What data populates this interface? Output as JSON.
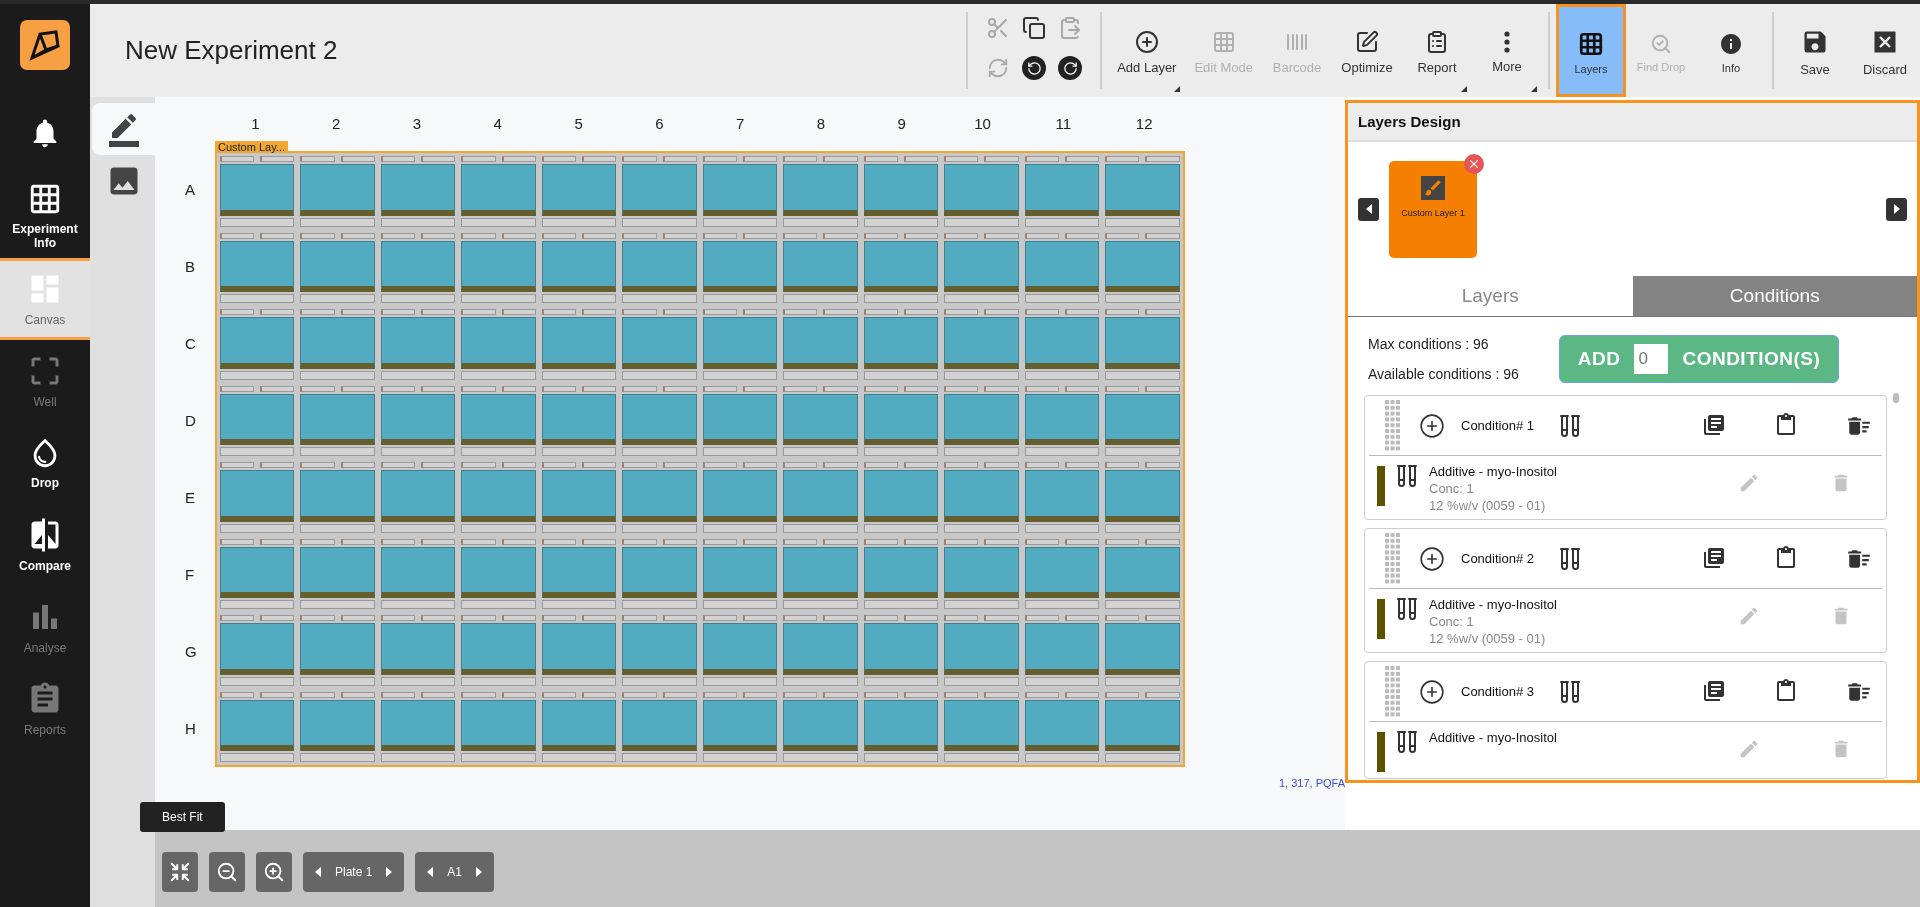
{
  "sidebar": {
    "items": [
      {
        "kind": "bell",
        "selected": false,
        "disabled": false
      },
      {
        "kind": "info",
        "label": "Experiment Info",
        "selected": false,
        "disabled": false
      },
      {
        "kind": "canvas",
        "label": "Canvas",
        "selected": true,
        "disabled": false
      },
      {
        "kind": "well",
        "label": "Well",
        "selected": false,
        "disabled": true
      },
      {
        "kind": "drop",
        "label": "Drop",
        "selected": false,
        "disabled": false
      },
      {
        "kind": "compare",
        "label": "Compare",
        "selected": false,
        "disabled": false
      },
      {
        "kind": "analyse",
        "label": "Analyse",
        "selected": false,
        "disabled": true
      },
      {
        "kind": "reports",
        "label": "Reports",
        "selected": false,
        "disabled": true
      }
    ]
  },
  "header": {
    "title": "New Experiment 2"
  },
  "edit_tools": [
    {
      "kind": "cut",
      "disabled": true
    },
    {
      "kind": "copy",
      "disabled": false
    },
    {
      "kind": "paste",
      "disabled": true
    },
    {
      "kind": "refresh",
      "disabled": true
    },
    {
      "kind": "undo",
      "disabled": false
    },
    {
      "kind": "redo",
      "disabled": false
    }
  ],
  "toolbar": {
    "groups": [
      {
        "buttons": [
          {
            "kind": "add",
            "label": "Add Layer",
            "disabled": false,
            "selected": false,
            "menu": true
          },
          {
            "kind": "edit",
            "label": "Edit Mode",
            "disabled": true,
            "selected": false,
            "menu": false
          },
          {
            "kind": "barcode",
            "label": "Barcode",
            "disabled": true,
            "selected": false,
            "menu": false
          },
          {
            "kind": "optimize",
            "label": "Optimize",
            "disabled": false,
            "selected": false,
            "menu": false
          },
          {
            "kind": "report",
            "label": "Report",
            "disabled": false,
            "selected": false,
            "menu": true
          },
          {
            "kind": "more",
            "label": "More",
            "disabled": false,
            "selected": false,
            "menu": true
          }
        ]
      },
      {
        "buttons": [
          {
            "kind": "layers",
            "label": "Layers",
            "disabled": false,
            "selected": true,
            "menu": false
          },
          {
            "kind": "find",
            "label": "Find Drop",
            "disabled": true,
            "selected": false,
            "menu": false
          },
          {
            "kind": "info",
            "label": "Info",
            "disabled": false,
            "selected": false,
            "menu": false
          }
        ]
      },
      {
        "buttons": [
          {
            "kind": "save",
            "label": "Save",
            "disabled": false,
            "selected": false,
            "menu": false
          },
          {
            "kind": "discard",
            "label": "Discard",
            "disabled": false,
            "selected": false,
            "menu": false
          }
        ]
      }
    ]
  },
  "view_tabs": [
    {
      "kind": "edit",
      "selected": true
    },
    {
      "kind": "image",
      "selected": false
    }
  ],
  "plate": {
    "columns": [
      "1",
      "2",
      "3",
      "4",
      "5",
      "6",
      "7",
      "8",
      "9",
      "10",
      "11",
      "12"
    ],
    "rows": [
      "A",
      "B",
      "C",
      "D",
      "E",
      "F",
      "G",
      "H"
    ],
    "layer_tag": "Custom Lay...",
    "footer": "1, 317, PQFA"
  },
  "bottom_bar": {
    "tooltip": "Best Fit",
    "plate_nav": "Plate 1",
    "well_nav": "A1"
  },
  "layers_panel": {
    "title": "Layers Design",
    "layers": [
      {
        "label": "Custom Layer 1"
      }
    ],
    "tabs": [
      {
        "label": "Layers",
        "selected": false
      },
      {
        "label": "Conditions",
        "selected": true
      }
    ],
    "max_conditions": "Max conditions : 96",
    "available_conditions": "Available conditions : 96",
    "add_button": {
      "prefix": "ADD",
      "value": "0",
      "suffix": "CONDITION(S)"
    },
    "conditions": [
      {
        "title": "Condition# 1",
        "additives": [
          {
            "name": "Additive - myo-Inositol",
            "conc": "Conc: 1",
            "amount": "12 %w/v (0059 - 01)",
            "color": "#5c5200"
          }
        ]
      },
      {
        "title": "Condition# 2",
        "additives": [
          {
            "name": "Additive - myo-Inositol",
            "conc": "Conc: 1",
            "amount": "12 %w/v (0059 - 01)",
            "color": "#5c5200"
          }
        ]
      },
      {
        "title": "Condition# 3",
        "additives": [
          {
            "name": "Additive - myo-Inositol",
            "color": "#5c5200"
          }
        ]
      }
    ]
  }
}
